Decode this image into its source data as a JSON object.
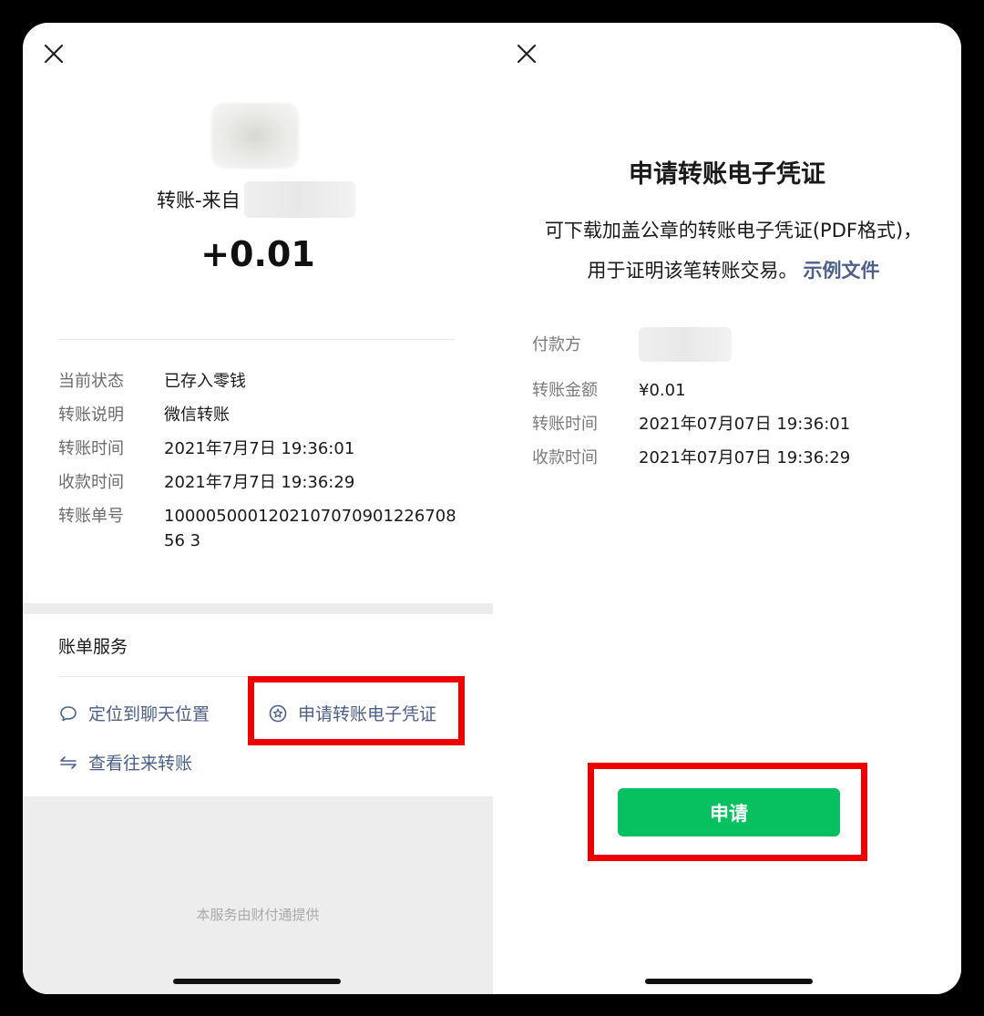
{
  "left": {
    "close_icon": "close-icon",
    "from_prefix": "转账-来自",
    "amount": "+0.01",
    "details": [
      {
        "label": "当前状态",
        "value": "已存入零钱"
      },
      {
        "label": "转账说明",
        "value": "微信转账"
      },
      {
        "label": "转账时间",
        "value": "2021年7月7日 19:36:01"
      },
      {
        "label": "收款时间",
        "value": "2021年7月7日 19:36:29"
      },
      {
        "label": "转账单号",
        "value": "100005000120210707090122670856 3"
      }
    ],
    "services_title": "账单服务",
    "links": {
      "chat": {
        "label": "定位到聊天位置",
        "icon": "chat-bubble-icon"
      },
      "voucher": {
        "label": "申请转账电子凭证",
        "icon": "star-badge-icon"
      },
      "history": {
        "label": "查看往来转账",
        "icon": "transfer-arrows-icon"
      }
    },
    "footer": "本服务由财付通提供"
  },
  "right": {
    "close_icon": "close-icon",
    "title": "申请转账电子凭证",
    "description": "可下载加盖公章的转账电子凭证(PDF格式)，用于证明该笔转账交易。",
    "sample_link": "示例文件",
    "details": [
      {
        "label": "付款方",
        "value": ""
      },
      {
        "label": "转账金额",
        "value": "¥0.01"
      },
      {
        "label": "转账时间",
        "value": "2021年07月07日 19:36:01"
      },
      {
        "label": "收款时间",
        "value": "2021年07月07日 19:36:29"
      }
    ],
    "apply_button": "申请"
  },
  "colors": {
    "highlight": "#ee0000",
    "link": "#4b5f8a",
    "primary_button": "#07c160"
  }
}
